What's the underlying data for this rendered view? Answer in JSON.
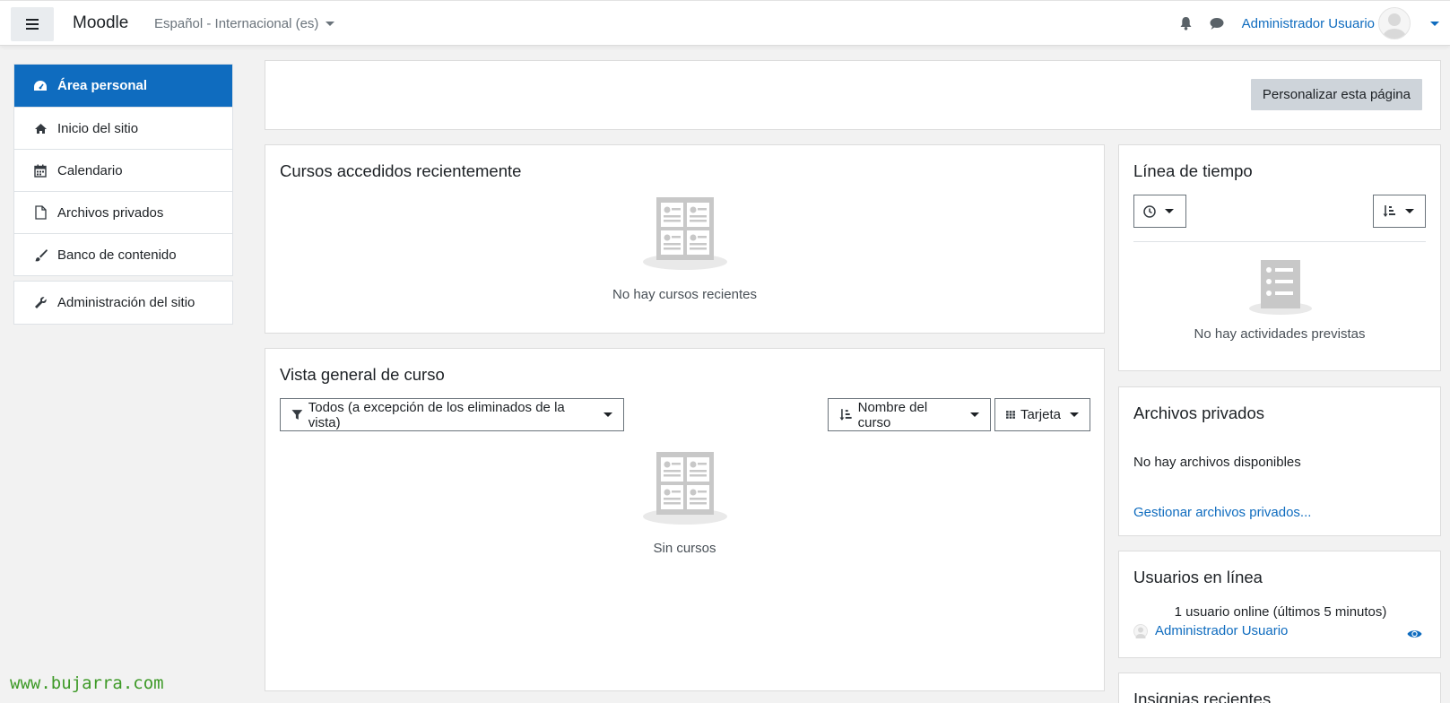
{
  "navbar": {
    "brand": "Moodle",
    "language": "Español - Internacional (es)",
    "user_name": "Administrador Usuario",
    "icons": [
      "menu-icon",
      "bell-icon",
      "chat-icon",
      "avatar-icon"
    ]
  },
  "sidebar": {
    "items": [
      {
        "label": "Área personal",
        "icon": "dashboard-icon",
        "active": true
      },
      {
        "label": "Inicio del sitio",
        "icon": "home-icon"
      },
      {
        "label": "Calendario",
        "icon": "calendar-icon"
      },
      {
        "label": "Archivos privados",
        "icon": "file-icon"
      },
      {
        "label": "Banco de contenido",
        "icon": "brush-icon"
      }
    ],
    "admin": {
      "label": "Administración del sitio",
      "icon": "wrench-icon"
    }
  },
  "main": {
    "customize_button": "Personalizar esta página",
    "recent_courses": {
      "title": "Cursos accedidos recientemente",
      "empty": "No hay cursos recientes"
    },
    "course_overview": {
      "title": "Vista general de curso",
      "filter_label": "Todos (a excepción de los eliminados de la vista)",
      "sort_label": "Nombre del curso",
      "view_label": "Tarjeta",
      "empty": "Sin cursos"
    }
  },
  "right": {
    "timeline": {
      "title": "Línea de tiempo",
      "empty": "No hay actividades previstas"
    },
    "private_files": {
      "title": "Archivos privados",
      "empty": "No hay archivos disponibles",
      "manage_link": "Gestionar archivos privados..."
    },
    "online_users": {
      "title": "Usuarios en línea",
      "summary": "1 usuario online (últimos 5 minutos)",
      "user": "Administrador Usuario"
    },
    "badges": {
      "title": "Insignias recientes"
    }
  },
  "watermark": "www.bujarra.com",
  "colors": {
    "primary": "#0f6cbf",
    "background": "#f2f2f2",
    "secondary_button": "#ced4da",
    "watermark": "#3e9a28"
  }
}
